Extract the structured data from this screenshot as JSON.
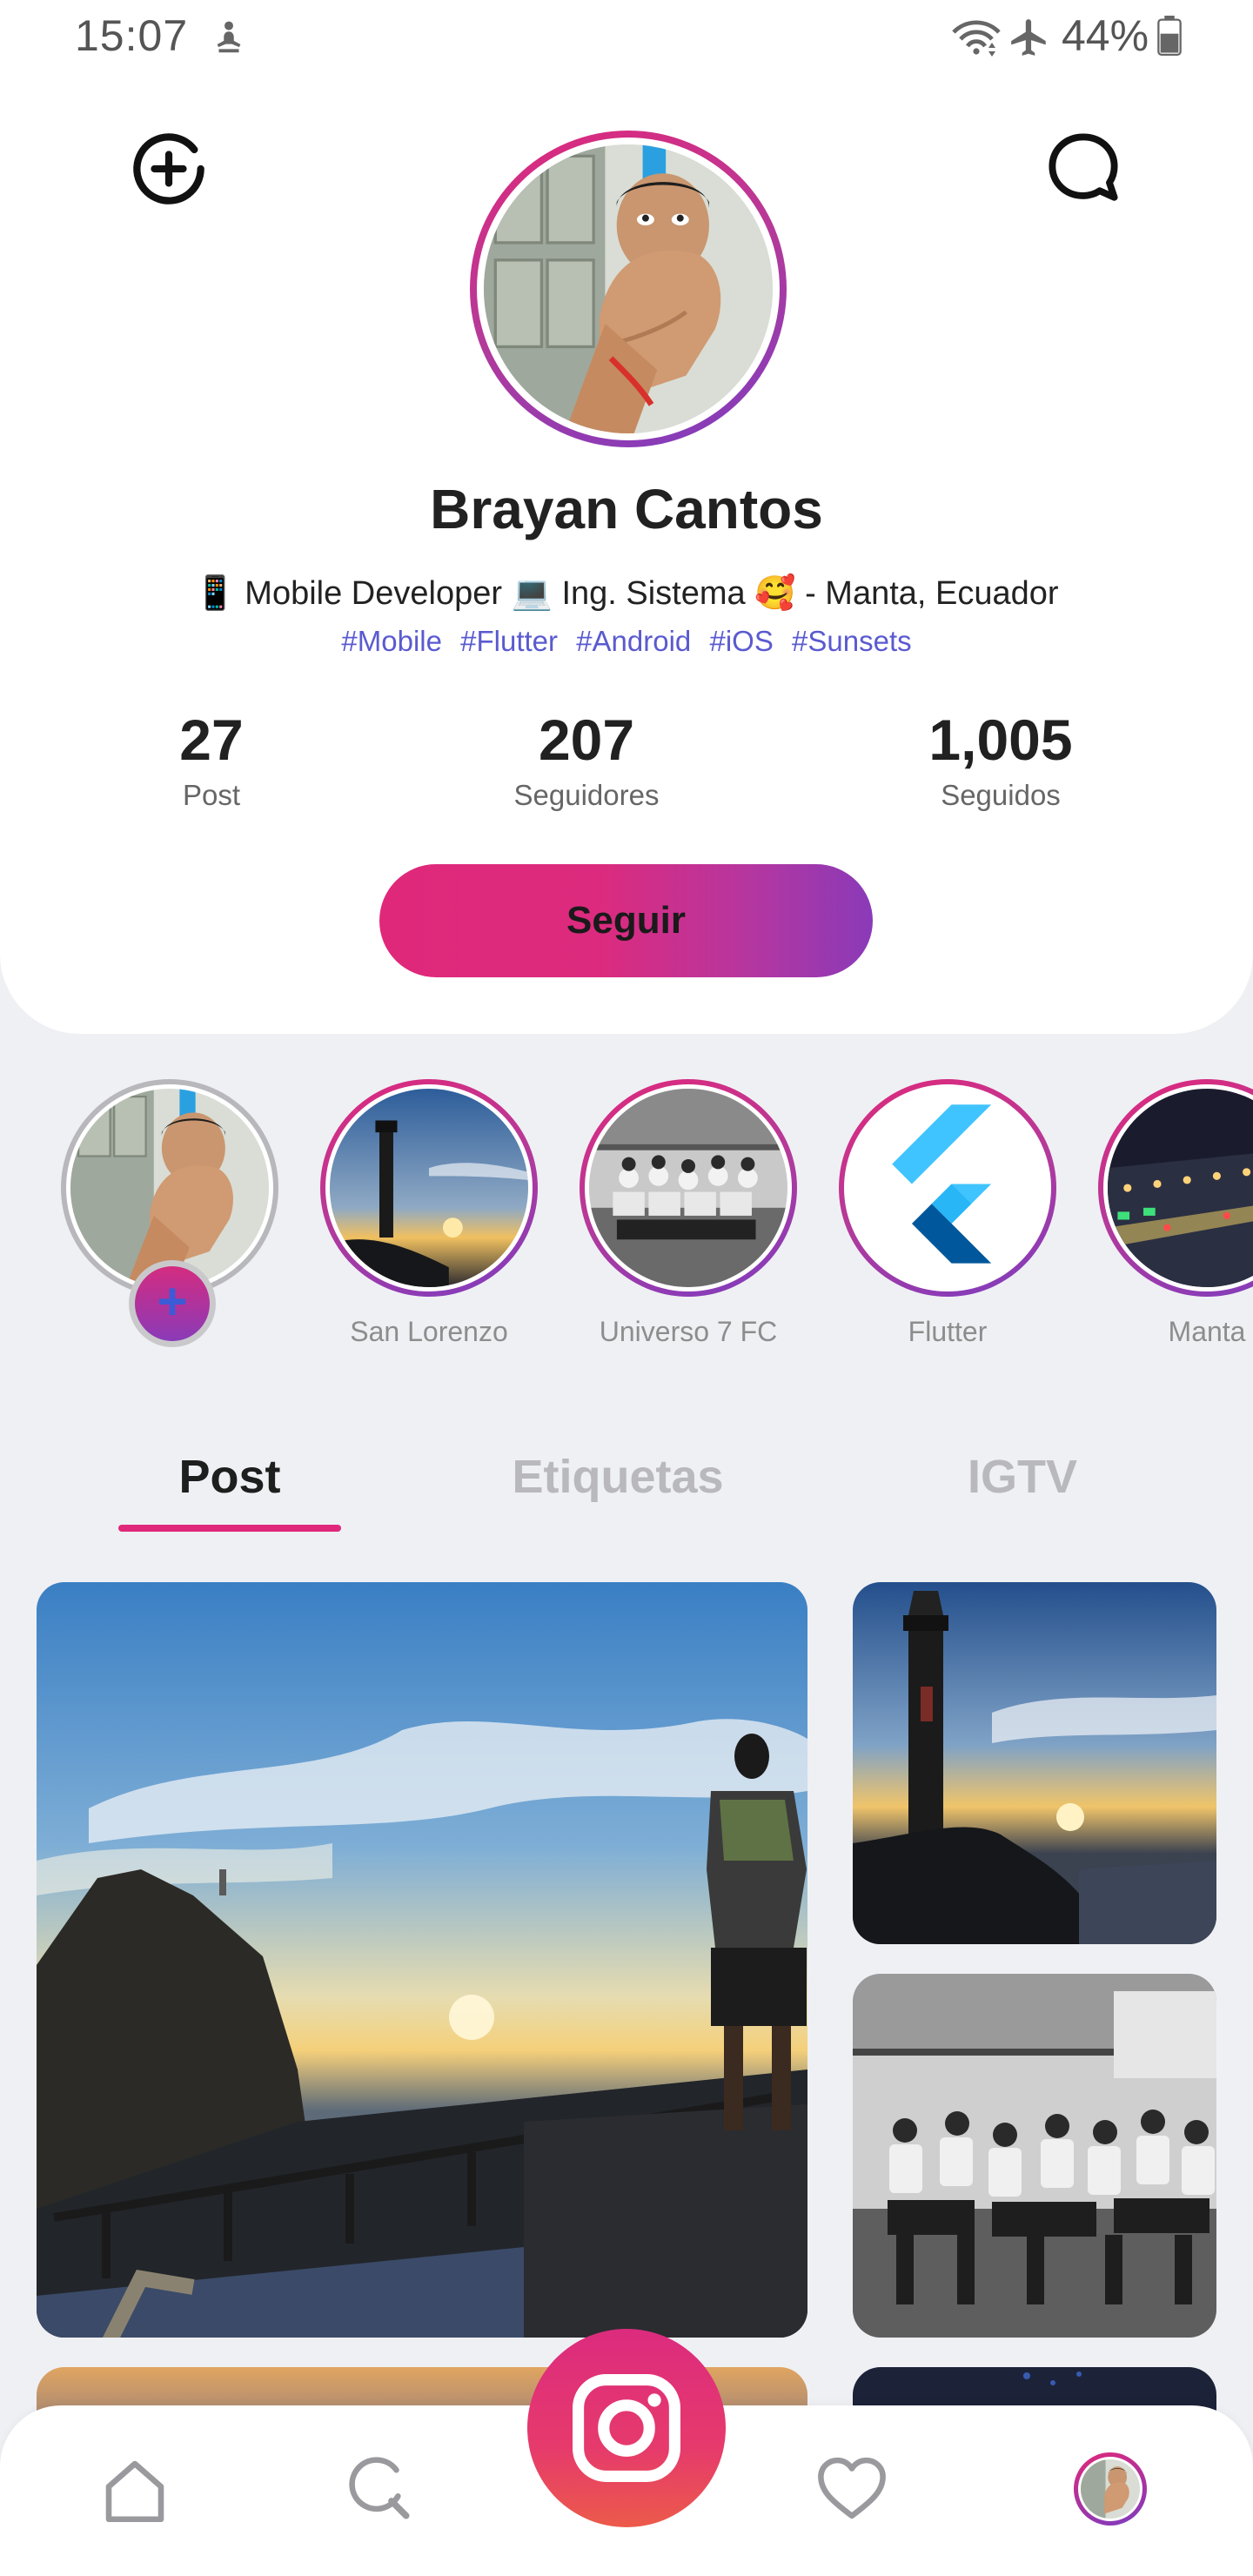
{
  "status_bar": {
    "time": "15:07",
    "battery": "44%"
  },
  "profile": {
    "name": "Brayan Cantos",
    "bio": "📱 Mobile Developer 💻 Ing. Sistema 🥰 - Manta, Ecuador",
    "tags": [
      "#Mobile",
      "#Flutter",
      "#Android",
      "#iOS",
      "#Sunsets"
    ]
  },
  "stats": {
    "posts": {
      "value": "27",
      "label": "Post"
    },
    "followers": {
      "value": "207",
      "label": "Seguidores"
    },
    "following": {
      "value": "1,005",
      "label": "Seguidos"
    }
  },
  "follow_button": {
    "label": "Seguir"
  },
  "stories": [
    {
      "label": ""
    },
    {
      "label": "San Lorenzo"
    },
    {
      "label": "Universo 7 FC"
    },
    {
      "label": "Flutter"
    },
    {
      "label": "Manta"
    }
  ],
  "tabs": [
    {
      "label": "Post",
      "active": true
    },
    {
      "label": "Etiquetas",
      "active": false
    },
    {
      "label": "IGTV",
      "active": false
    }
  ],
  "colors": {
    "accent_pink": "#e0287a",
    "accent_purple": "#7c3cc0",
    "tag_blue": "#5a5ad0",
    "background": "#eff0f4"
  },
  "icons": {
    "add_story": "add-circle-icon",
    "messages": "chat-bubble-icon",
    "home": "home-icon",
    "search": "search-icon",
    "camera": "camera-icon",
    "likes": "heart-icon"
  }
}
